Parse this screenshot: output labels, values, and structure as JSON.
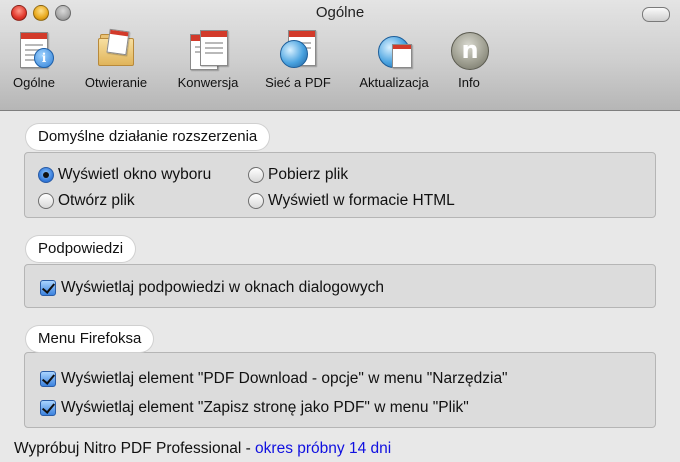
{
  "window": {
    "title": "Ogólne"
  },
  "toolbar": {
    "items": [
      {
        "label": "Ogólne",
        "icon": "general-doc-icon"
      },
      {
        "label": "Otwieranie",
        "icon": "folder-icon"
      },
      {
        "label": "Konwersja",
        "icon": "convert-doc-icon"
      },
      {
        "label": "Sieć a PDF",
        "icon": "web-globe-icon"
      },
      {
        "label": "Aktualizacja",
        "icon": "update-globe-icon"
      },
      {
        "label": "Info",
        "icon": "info-n-icon"
      }
    ]
  },
  "groups": {
    "default_action": {
      "title": "Domyślne działanie rozszerzenia",
      "options": [
        {
          "label": "Wyświetl okno wyboru",
          "selected": true
        },
        {
          "label": "Pobierz plik",
          "selected": false
        },
        {
          "label": "Otwórz plik",
          "selected": false
        },
        {
          "label": "Wyświetl w formacie HTML",
          "selected": false
        }
      ]
    },
    "tips": {
      "title": "Podpowiedzi",
      "checkbox_label": "Wyświetlaj podpowiedzi w oknach dialogowych",
      "checked": true
    },
    "firefox_menu": {
      "title": "Menu Firefoksa",
      "items": [
        {
          "label": "Wyświetlaj element \"PDF Download - opcje\" w menu \"Narzędzia\"",
          "checked": true
        },
        {
          "label": "Wyświetlaj element \"Zapisz stronę jako PDF\" w menu \"Plik\"",
          "checked": true
        }
      ]
    }
  },
  "footer": {
    "text": "Wypróbuj Nitro PDF Professional - ",
    "link": "okres próbny 14 dni"
  },
  "colors": {
    "link": "#1010e0",
    "accent": "#2e74d6"
  }
}
